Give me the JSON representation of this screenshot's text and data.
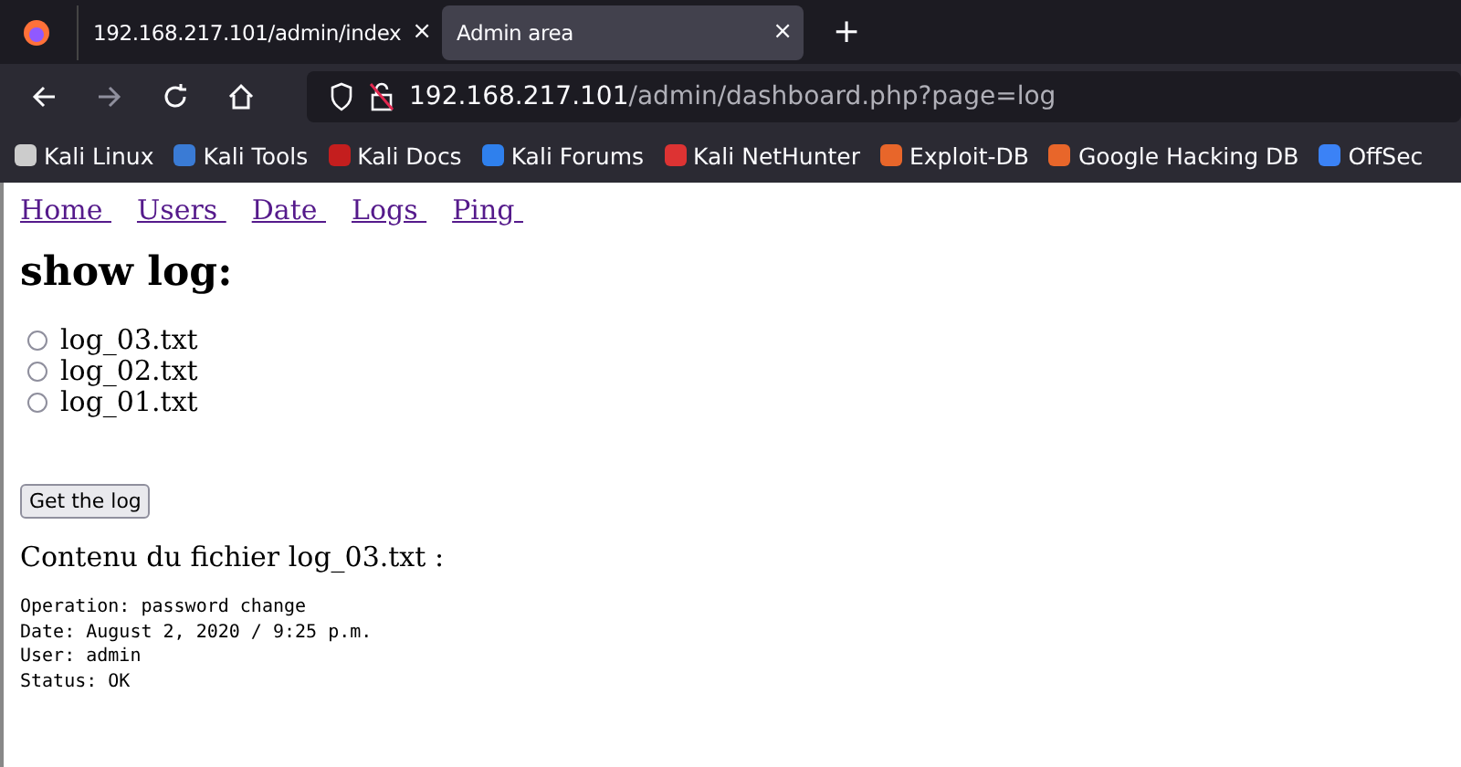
{
  "tabs": [
    {
      "title": "192.168.217.101/admin/index",
      "selected": false,
      "close": "×"
    },
    {
      "title": "Admin area",
      "selected": true,
      "close": "×"
    }
  ],
  "new_tab": "+",
  "address": {
    "host": "192.168.217.101",
    "path": "/admin/dashboard.php?page=log"
  },
  "bookmarks": [
    {
      "label": "Kali Linux",
      "color": "#cccccc"
    },
    {
      "label": "Kali Tools",
      "color": "#3a7bd5"
    },
    {
      "label": "Kali Docs",
      "color": "#c41e1e"
    },
    {
      "label": "Kali Forums",
      "color": "#2f80ed"
    },
    {
      "label": "Kali NetHunter",
      "color": "#d33"
    },
    {
      "label": "Exploit-DB",
      "color": "#e8662a"
    },
    {
      "label": "Google Hacking DB",
      "color": "#e8662a"
    },
    {
      "label": "OffSec",
      "color": "#3b82f6"
    }
  ],
  "nav_links": [
    "Home",
    "Users",
    "Date",
    "Logs",
    "Ping"
  ],
  "heading": "show log:",
  "radios": [
    {
      "label": "log_03.txt",
      "checked": false
    },
    {
      "label": "log_02.txt",
      "checked": false
    },
    {
      "label": "log_01.txt",
      "checked": false
    }
  ],
  "submit": "Get the log",
  "content_title": "Contenu du fichier log_03.txt :",
  "log_lines": [
    "Operation: password change",
    "Date: August 2, 2020 / 9:25 p.m.",
    "User: admin",
    "Status: OK"
  ]
}
